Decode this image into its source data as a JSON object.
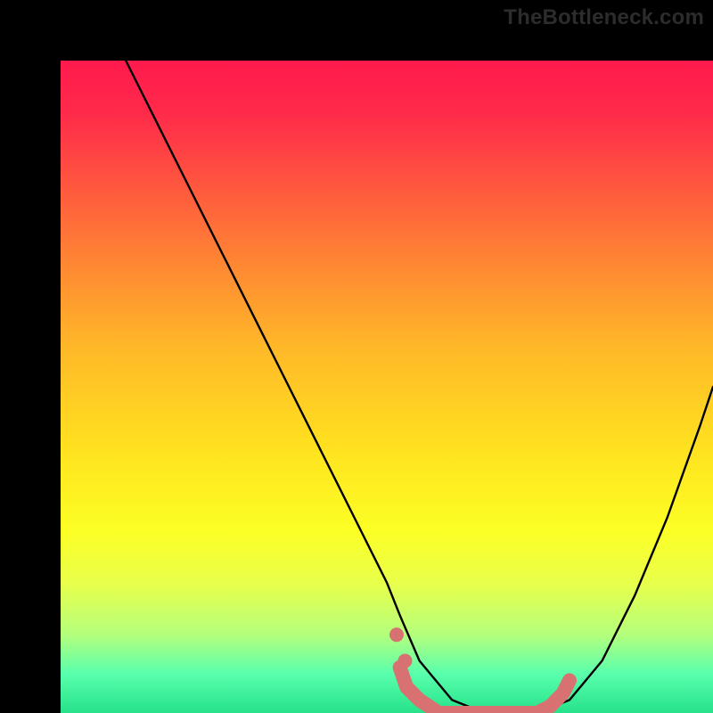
{
  "watermark": "TheBottleneck.com",
  "chart_data": {
    "type": "line",
    "title": "",
    "xlabel": "",
    "ylabel": "",
    "xlim": [
      0,
      100
    ],
    "ylim": [
      0,
      100
    ],
    "series": [
      {
        "name": "black-curve",
        "color": "#000000",
        "x": [
          10,
          15,
          20,
          25,
          30,
          35,
          40,
          45,
          50,
          52,
          55,
          60,
          65,
          70,
          73,
          78,
          83,
          88,
          93,
          98,
          100
        ],
        "y": [
          100,
          90,
          80,
          70,
          60,
          50,
          40,
          30,
          20,
          15,
          8,
          2,
          0,
          0,
          0,
          2,
          8,
          18,
          30,
          44,
          50
        ]
      },
      {
        "name": "pink-highlight",
        "color": "#d87272",
        "x": [
          52,
          53,
          55,
          58,
          62,
          66,
          70,
          73,
          75,
          77,
          78
        ],
        "y": [
          7,
          4,
          2,
          0,
          0,
          0,
          0,
          0,
          1,
          3,
          5
        ]
      }
    ],
    "background_gradient": {
      "stops": [
        {
          "pos": 0,
          "color": "#ff1a4d"
        },
        {
          "pos": 60,
          "color": "#ffe31f"
        },
        {
          "pos": 100,
          "color": "#26e28a"
        }
      ]
    }
  }
}
